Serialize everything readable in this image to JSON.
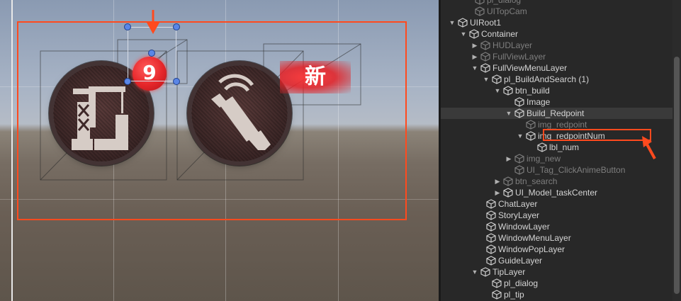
{
  "scene": {
    "badge_number": "9",
    "badge_new_text": "新",
    "colors": {
      "selection": "#ff4a1e",
      "badge_red": "#e5262a",
      "icon_fill": "#d6ccc6"
    }
  },
  "hierarchy": {
    "rows": [
      {
        "label": "pl_dialog",
        "dim": true,
        "arrow": ""
      },
      {
        "label": "UITopCam",
        "dim": true,
        "arrow": ""
      },
      {
        "label": "UIRoot1",
        "dim": false,
        "arrow": "down"
      },
      {
        "label": "Container",
        "dim": false,
        "arrow": "down"
      },
      {
        "label": "HUDLayer",
        "dim": true,
        "arrow": "right"
      },
      {
        "label": "FullViewLayer",
        "dim": true,
        "arrow": "right"
      },
      {
        "label": "FullViewMenuLayer",
        "dim": false,
        "arrow": "down"
      },
      {
        "label": "pl_BuildAndSearch (1)",
        "dim": false,
        "arrow": "down"
      },
      {
        "label": "btn_build",
        "dim": false,
        "arrow": "down"
      },
      {
        "label": "Image",
        "dim": false,
        "arrow": ""
      },
      {
        "label": "Build_Redpoint",
        "dim": false,
        "arrow": "down"
      },
      {
        "label": "img_redpoint",
        "dim": true,
        "arrow": ""
      },
      {
        "label": "img_redpointNum",
        "dim": false,
        "arrow": "down"
      },
      {
        "label": "lbl_num",
        "dim": false,
        "arrow": ""
      },
      {
        "label": "img_new",
        "dim": true,
        "arrow": "right"
      },
      {
        "label": "UI_Tag_ClickAnimeButton",
        "dim": true,
        "arrow": ""
      },
      {
        "label": "btn_search",
        "dim": true,
        "arrow": "right"
      },
      {
        "label": "UI_Model_taskCenter",
        "dim": false,
        "arrow": "right"
      },
      {
        "label": "ChatLayer",
        "dim": false,
        "arrow": ""
      },
      {
        "label": "StoryLayer",
        "dim": false,
        "arrow": ""
      },
      {
        "label": "WindowLayer",
        "dim": false,
        "arrow": ""
      },
      {
        "label": "WindowMenuLayer",
        "dim": false,
        "arrow": ""
      },
      {
        "label": "WindowPopLayer",
        "dim": false,
        "arrow": ""
      },
      {
        "label": "GuideLayer",
        "dim": false,
        "arrow": ""
      },
      {
        "label": "TipLayer",
        "dim": false,
        "arrow": "down"
      },
      {
        "label": "pl_dialog",
        "dim": false,
        "arrow": ""
      },
      {
        "label": "pl_tip",
        "dim": false,
        "arrow": ""
      }
    ]
  }
}
